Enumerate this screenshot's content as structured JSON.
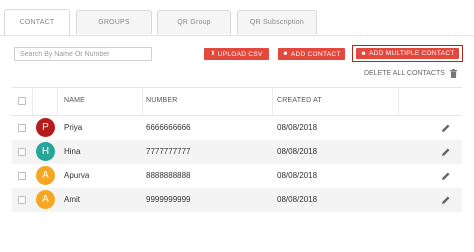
{
  "tabs": [
    {
      "label": "CONTACT",
      "active": true
    },
    {
      "label": "GROUPS",
      "active": false
    },
    {
      "label": "QR Group",
      "active": false
    },
    {
      "label": "QR Subscription",
      "active": false
    }
  ],
  "search": {
    "placeholder": "Search By Name Or Number",
    "value": ""
  },
  "actions": {
    "upload_csv": "UPLOAD CSV",
    "add_contact": "ADD CONTACT",
    "add_multiple_contact": "ADD MULTIPLE CONTACT",
    "delete_all": "DELETE ALL CONTACTS",
    "button_color": "#e2483c"
  },
  "table": {
    "headers": {
      "name": "NAME",
      "number": "NUMBER",
      "created_at": "CREATED AT"
    },
    "rows": [
      {
        "initial": "P",
        "avatar_color": "#b71c1c",
        "name": "Priya",
        "number": "6666666666",
        "created_at": "08/08/2018"
      },
      {
        "initial": "H",
        "avatar_color": "#26a69a",
        "name": "Hina",
        "number": "7777777777",
        "created_at": "08/08/2018"
      },
      {
        "initial": "A",
        "avatar_color": "#f5a623",
        "name": "Apurva",
        "number": "8888888888",
        "created_at": "08/08/2018"
      },
      {
        "initial": "A",
        "avatar_color": "#f5a623",
        "name": "Amit",
        "number": "9999999999",
        "created_at": "08/08/2018"
      }
    ]
  }
}
